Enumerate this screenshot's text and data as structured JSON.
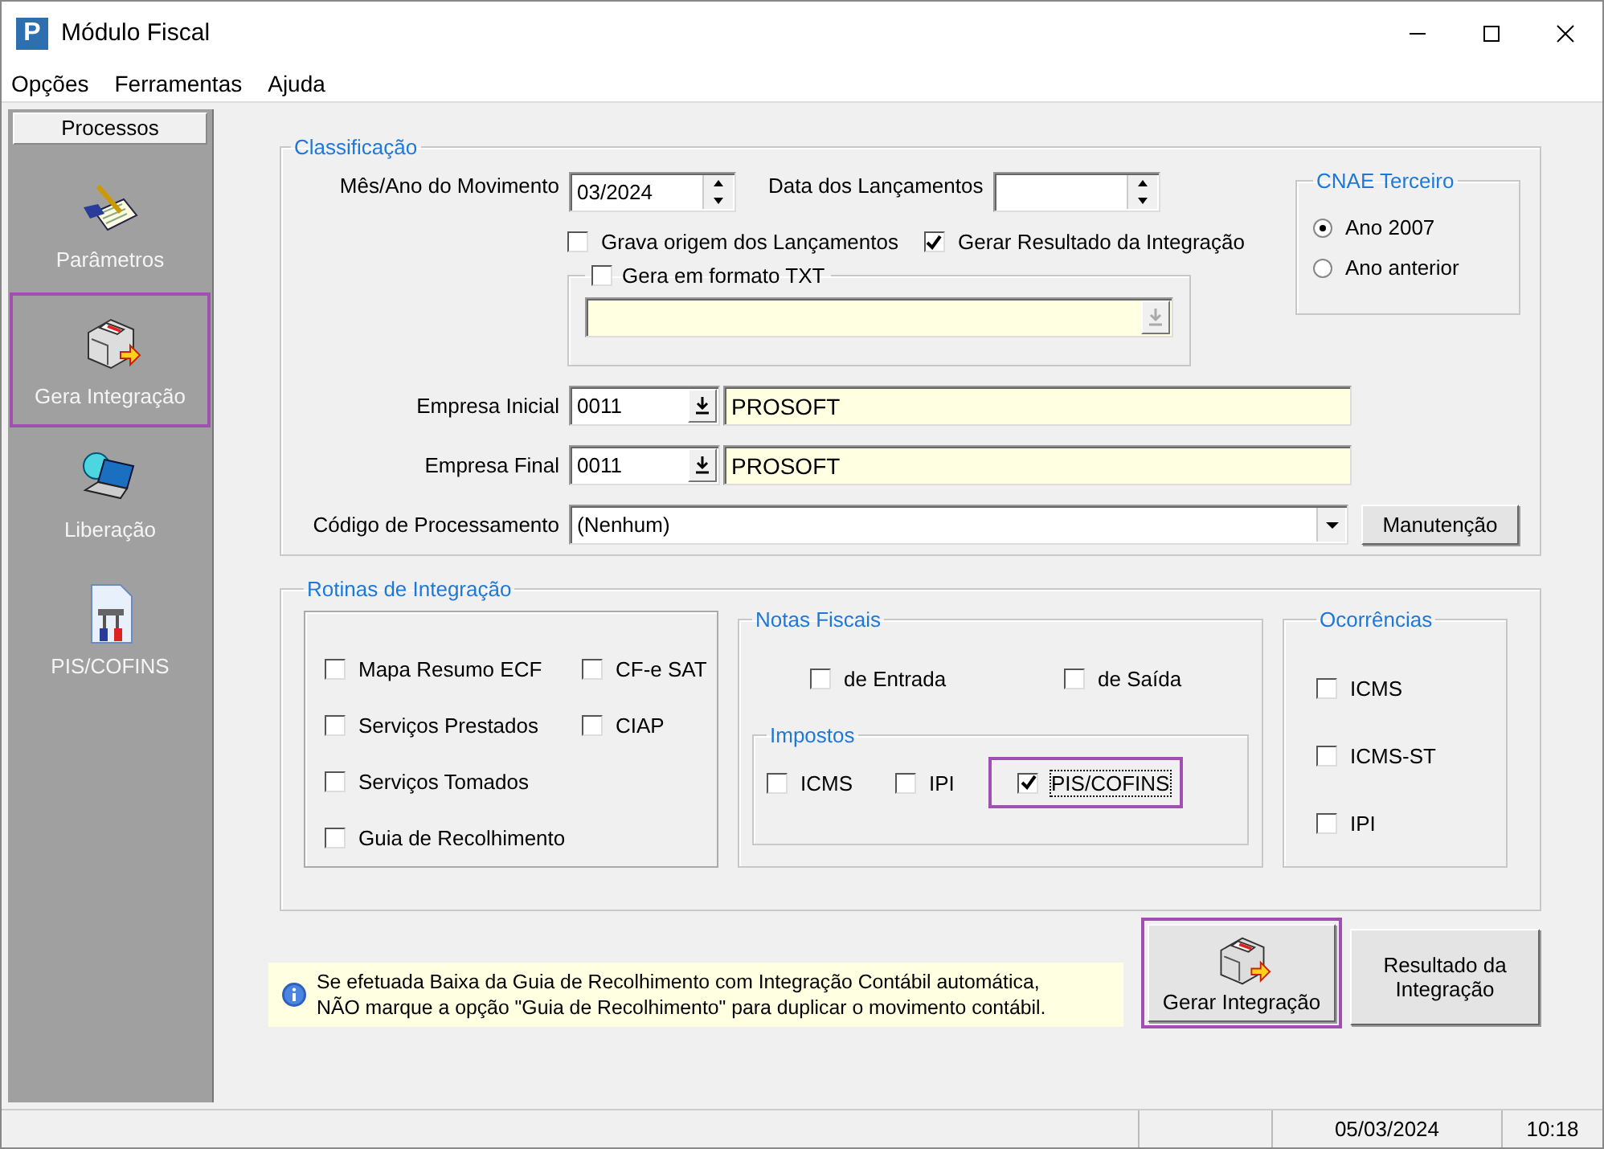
{
  "window": {
    "logo": "P",
    "title": "Módulo Fiscal"
  },
  "menu": [
    "Opções",
    "Ferramentas",
    "Ajuda"
  ],
  "sidebar": {
    "title": "Processos",
    "items": [
      {
        "kind": "notepad",
        "label": "Parâmetros",
        "highlighted": false
      },
      {
        "kind": "machine",
        "label": "Gera Integração",
        "highlighted": true
      },
      {
        "kind": "laptop",
        "label": "Liberação",
        "highlighted": false
      },
      {
        "kind": "document",
        "label": "PIS/COFINS",
        "highlighted": false
      }
    ]
  },
  "classificacao": {
    "legend": "Classificação",
    "mes_ano": {
      "label": "Mês/Ano do Movimento",
      "value": "03/2024"
    },
    "data_lancamentos": {
      "label": "Data dos Lançamentos"
    },
    "options": [
      {
        "label": "Grava origem dos Lançamentos",
        "checked": false
      },
      {
        "label": "Gerar Resultado da Integração",
        "checked": true
      }
    ],
    "txt": {
      "label": "Gera em formato TXT",
      "checked": false
    },
    "empresas": [
      {
        "label": "Empresa Inicial",
        "code": "0011",
        "name": "PROSOFT"
      },
      {
        "label": "Empresa Final",
        "code": "0011",
        "name": "PROSOFT"
      }
    ],
    "codigo": {
      "label": "Código de Processamento",
      "value": "(Nenhum)"
    },
    "manutencao_button": "Manutenção",
    "cnae": {
      "legend": "CNAE Terceiro",
      "options": [
        {
          "label": "Ano 2007",
          "selected": true
        },
        {
          "label": "Ano anterior",
          "selected": false
        }
      ]
    }
  },
  "rotinas": {
    "legend": "Rotinas de Integração",
    "column_1": [
      {
        "label": "Mapa Resumo ECF",
        "checked": false
      },
      {
        "label": "Serviços Prestados",
        "checked": false
      },
      {
        "label": "Serviços Tomados",
        "checked": false
      },
      {
        "label": "Guia de Recolhimento",
        "checked": false
      }
    ],
    "column_2": [
      {
        "label": "CF-e SAT",
        "checked": false
      },
      {
        "label": "CIAP",
        "checked": false
      }
    ],
    "notas_fiscais": {
      "legend": "Notas Fiscais",
      "options": [
        {
          "label": "de Entrada",
          "checked": false
        },
        {
          "label": "de Saída",
          "checked": false
        }
      ],
      "impostos": {
        "legend": "Impostos",
        "options": [
          {
            "label": "ICMS",
            "checked": false,
            "highlighted": false
          },
          {
            "label": "IPI",
            "checked": false,
            "highlighted": false
          },
          {
            "label": "PIS/COFINS",
            "checked": true,
            "highlighted": true
          }
        ]
      }
    },
    "ocorrencias": {
      "legend": "Ocorrências",
      "options": [
        {
          "label": "ICMS",
          "checked": false
        },
        {
          "label": "ICMS-ST",
          "checked": false
        },
        {
          "label": "IPI",
          "checked": false
        }
      ]
    }
  },
  "info": "Se efetuada Baixa da Guia de Recolhimento com Integração Contábil automática,\nNÃO marque a opção \"Guia de Recolhimento\" para duplicar o movimento contábil.",
  "buttons": [
    {
      "kind": "icon",
      "label": "Gerar Integração",
      "highlighted": true
    },
    {
      "kind": "text",
      "label": "Resultado da Integração",
      "highlighted": false
    }
  ],
  "status_bar": {
    "date": "05/03/2024",
    "time": "10:18"
  }
}
